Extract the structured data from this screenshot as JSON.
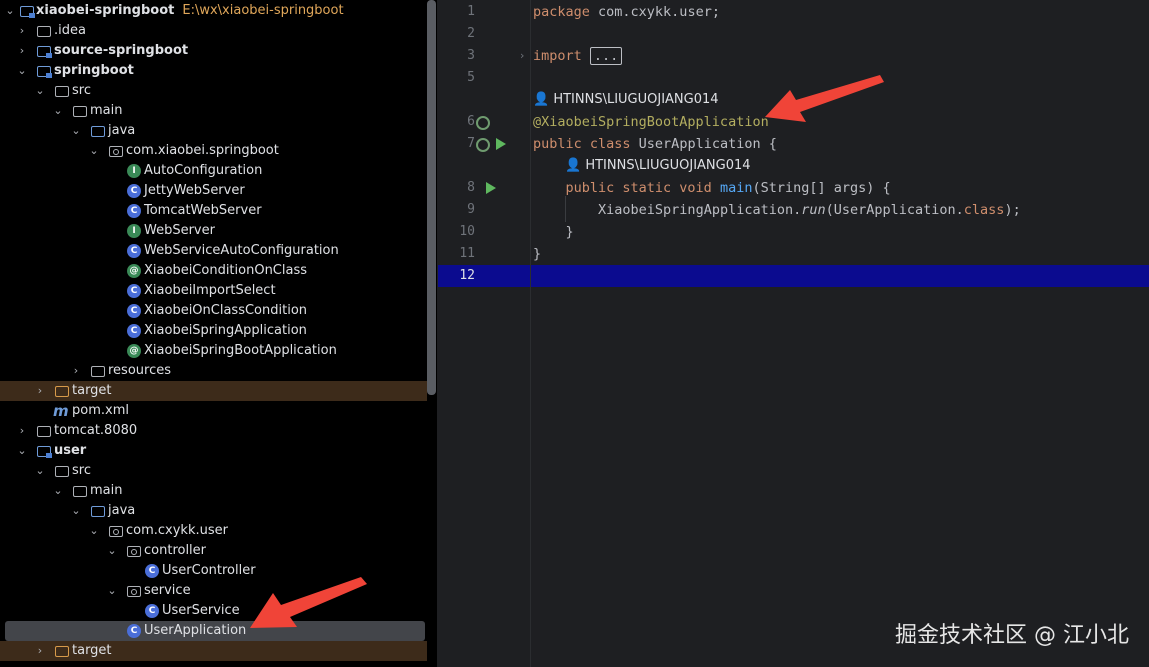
{
  "project_tree": {
    "root_label": "xiaobei-springboot",
    "root_path": "E:\\wx\\xiaobei-springboot",
    "items": [
      {
        "label": "xiaobei-springboot",
        "level": 0
      },
      {
        "label": ".idea"
      },
      {
        "label": "source-springboot"
      },
      {
        "label": "springboot"
      },
      {
        "label": "src"
      },
      {
        "label": "main"
      },
      {
        "label": "java"
      },
      {
        "label": "com.xiaobei.springboot"
      },
      {
        "label": "AutoConfiguration"
      },
      {
        "label": "JettyWebServer"
      },
      {
        "label": "TomcatWebServer"
      },
      {
        "label": "WebServer"
      },
      {
        "label": "WebServiceAutoConfiguration"
      },
      {
        "label": "XiaobeiConditionOnClass"
      },
      {
        "label": "XiaobeiImportSelect"
      },
      {
        "label": "XiaobeiOnClassCondition"
      },
      {
        "label": "XiaobeiSpringApplication"
      },
      {
        "label": "XiaobeiSpringBootApplication"
      },
      {
        "label": "resources"
      },
      {
        "label": "target"
      },
      {
        "label": "pom.xml"
      },
      {
        "label": "tomcat.8080"
      },
      {
        "label": "user"
      },
      {
        "label": "src"
      },
      {
        "label": "main"
      },
      {
        "label": "java"
      },
      {
        "label": "com.cxykk.user"
      },
      {
        "label": "controller"
      },
      {
        "label": "UserController"
      },
      {
        "label": "service"
      },
      {
        "label": "UserService"
      },
      {
        "label": "UserApplication"
      },
      {
        "label": "target"
      }
    ]
  },
  "editor": {
    "line_numbers": [
      "1",
      "2",
      "3",
      "5",
      "6",
      "7",
      "8",
      "9",
      "10",
      "11",
      "12"
    ],
    "author_hint": "HTINNS\\LIUGUOJIANG014",
    "code": {
      "l1_kw": "package",
      "l1_rest": " com.cxykk.user;",
      "l3_kw": "import",
      "l3_dots": "...",
      "l6_ann": "@XiaobeiSpringBootApplication",
      "l7_kw": "public class",
      "l7_rest": " UserApplication {",
      "l8_kw": "public static void",
      "l8_fn": "main",
      "l8_rest": "(String[] args) {",
      "l9_a": "XiaobeiSpringApplication.",
      "l9_run": "run",
      "l9_b": "(UserApplication.",
      "l9_kw": "class",
      "l9_c": ");",
      "l10": "}",
      "l11": "}"
    }
  },
  "watermark": "掘金技术社区 @ 江小北"
}
